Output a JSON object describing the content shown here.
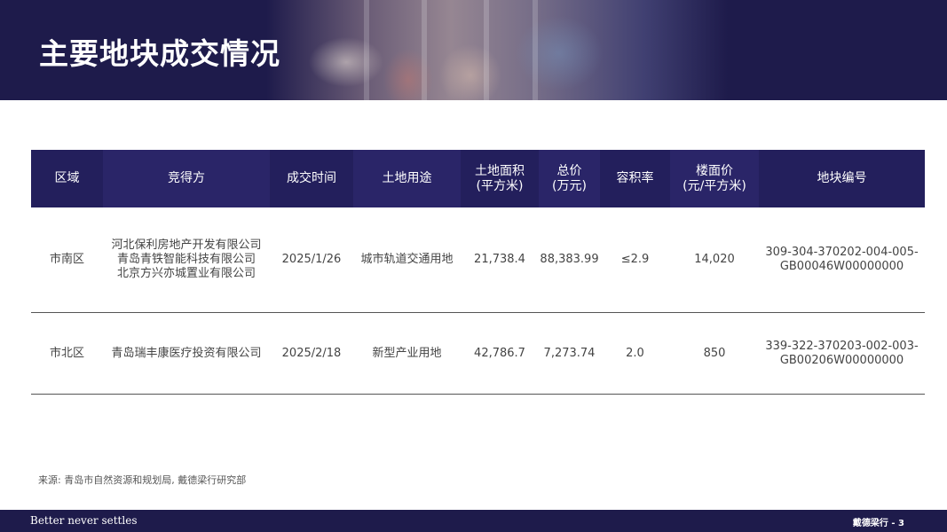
{
  "header": {
    "title": "主要地块成交情况"
  },
  "table": {
    "columns": [
      "区域",
      "竞得方",
      "成交时间",
      "土地用途",
      "土地面积\n(平方米)",
      "总价\n(万元)",
      "容积率",
      "楼面价\n(元/平方米)",
      "地块编号"
    ],
    "rows": [
      {
        "region": "市南区",
        "winners": [
          "河北保利房地产开发有限公司",
          "青岛青铁智能科技有限公司",
          "北京方兴亦城置业有限公司"
        ],
        "date": "2025/1/26",
        "usage": "城市轨道交通用地",
        "area": "21,738.4",
        "total_price": "88,383.99",
        "far": "≤2.9",
        "floor_price": "14,020",
        "parcel_id": [
          "309-304-370202-004-005-",
          "GB00046W00000000"
        ]
      },
      {
        "region": "市北区",
        "winners": [
          "青岛瑞丰康医疗投资有限公司"
        ],
        "date": "2025/2/18",
        "usage": "新型产业用地",
        "area": "42,786.7",
        "total_price": "7,273.74",
        "far": "2.0",
        "floor_price": "850",
        "parcel_id": [
          "339-322-370203-002-003-",
          "GB00206W00000000"
        ]
      }
    ]
  },
  "source": "来源: 青岛市自然资源和规划局, 戴德梁行研究部",
  "footer": {
    "tagline": "Better never settles",
    "page_info": "戴德梁行 - 3"
  },
  "colors": {
    "navy": "#1e1b4b",
    "header_cell": "#231f5c"
  }
}
